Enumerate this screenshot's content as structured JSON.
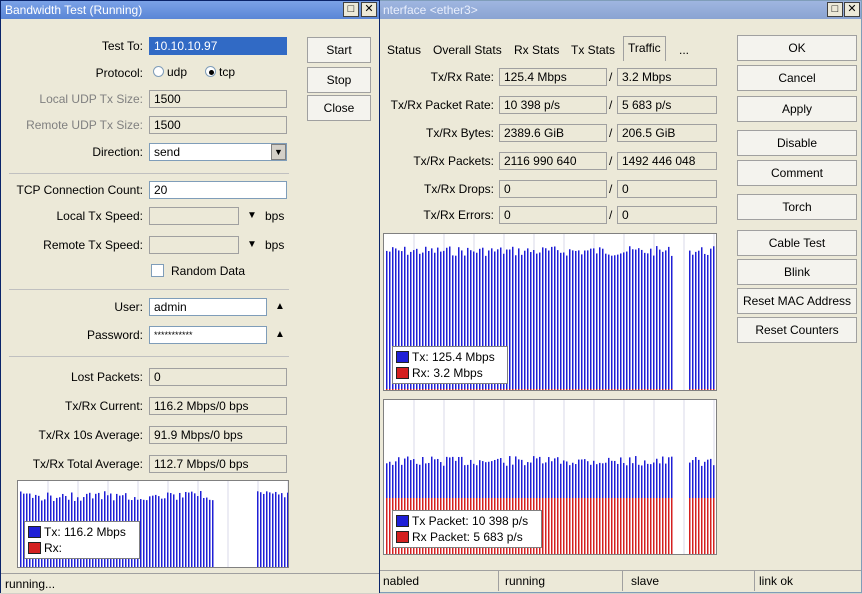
{
  "bw": {
    "title": "Bandwidth Test (Running)",
    "fields": {
      "test_to_label": "Test To:",
      "test_to": "10.10.10.97",
      "protocol_label": "Protocol:",
      "udp": "udp",
      "tcp": "tcp",
      "local_udp_label": "Local UDP Tx Size:",
      "local_udp": "1500",
      "remote_udp_label": "Remote UDP Tx Size:",
      "remote_udp": "1500",
      "direction_label": "Direction:",
      "direction": "send",
      "tcp_conn_label": "TCP Connection Count:",
      "tcp_conn": "20",
      "local_tx_label": "Local Tx Speed:",
      "local_tx_unit": "bps",
      "remote_tx_label": "Remote Tx Speed:",
      "remote_tx_unit": "bps",
      "random_data": "Random Data",
      "user_label": "User:",
      "user": "admin",
      "password_label": "Password:",
      "password": "***********",
      "lost_label": "Lost Packets:",
      "lost": "0",
      "current_label": "Tx/Rx Current:",
      "current": "116.2 Mbps/0 bps",
      "avg10_label": "Tx/Rx 10s Average:",
      "avg10": "91.9 Mbps/0 bps",
      "total_label": "Tx/Rx Total Average:",
      "total": "112.7 Mbps/0 bps"
    },
    "buttons": {
      "start": "Start",
      "stop": "Stop",
      "close": "Close"
    },
    "legend": {
      "tx": "Tx:  116.2 Mbps",
      "rx": "Rx:"
    },
    "status": "running..."
  },
  "iface": {
    "title": "nterface <ether3>",
    "tabs": [
      "Status",
      "Overall Stats",
      "Rx Stats",
      "Tx Stats",
      "Traffic",
      "..."
    ],
    "stats": [
      {
        "label": "Tx/Rx Rate:",
        "tx": "125.4 Mbps",
        "rx": "3.2 Mbps"
      },
      {
        "label": "Tx/Rx Packet Rate:",
        "tx": "10 398 p/s",
        "rx": "5 683 p/s"
      },
      {
        "label": "Tx/Rx Bytes:",
        "tx": "2389.6 GiB",
        "rx": "206.5 GiB"
      },
      {
        "label": "Tx/Rx Packets:",
        "tx": "2116 990 640",
        "rx": "1492 446 048"
      },
      {
        "label": "Tx/Rx Drops:",
        "tx": "0",
        "rx": "0"
      },
      {
        "label": "Tx/Rx Errors:",
        "tx": "0",
        "rx": "0"
      }
    ],
    "legend1": {
      "tx": "Tx:  125.4 Mbps",
      "rx": "Rx:  3.2 Mbps"
    },
    "legend2": {
      "tx": "Tx Packet:  10 398 p/s",
      "rx": "Rx Packet:  5 683 p/s"
    },
    "buttons": [
      "OK",
      "Cancel",
      "Apply",
      "Disable",
      "Comment",
      "Torch",
      "Cable Test",
      "Blink",
      "Reset MAC Address",
      "Reset Counters"
    ],
    "status": [
      "nabled",
      "running",
      "slave",
      "link ok"
    ]
  },
  "colors": {
    "tx": "#1f1fd6",
    "rx": "#d42020"
  }
}
